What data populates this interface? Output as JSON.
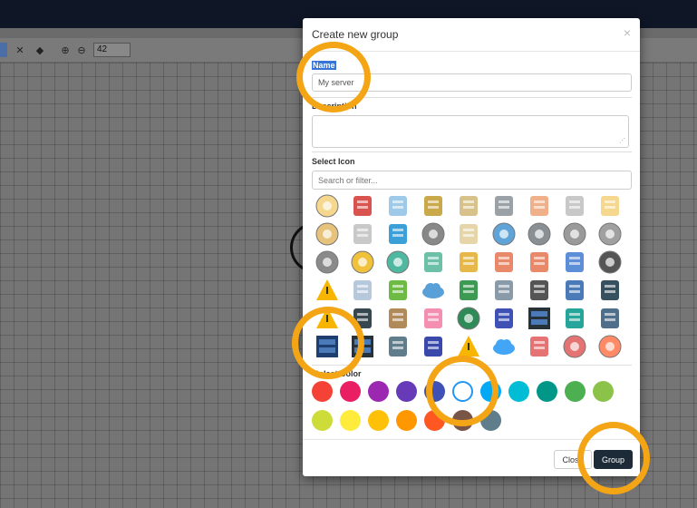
{
  "toolbar": {
    "zoom_value": "42"
  },
  "dialog": {
    "title": "Create new group",
    "close_glyph": "×",
    "name_label": "Name",
    "name_value": "My server",
    "description_label": "Description",
    "description_value": "",
    "select_icon_label": "Select Icon",
    "search_placeholder": "Search or filter...",
    "select_color_label": "Select Color",
    "close_button": "Close",
    "group_button": "Group"
  },
  "icons": [
    "keyhole-icon",
    "hacker-icon",
    "monitor-icon",
    "network-hub-icon",
    "database-icon",
    "server-tower-icon",
    "firewall-wall-icon",
    "server-icon",
    "search-shield-icon",
    "lock-icon",
    "usb-stick-icon",
    "network-graph-icon",
    "dashed-circle-icon",
    "document-key-icon",
    "compass-icon",
    "gears-icon",
    "disc-icon",
    "cd-icon",
    "gear-pair-icon",
    "keyhole-circle-icon",
    "user-circle-icon",
    "user-badge-icon",
    "satellite-dish-icon",
    "firewall-window-icon",
    "firewall-window-2-icon",
    "globe-window-icon",
    "dotted-circle-icon",
    "radiation-icon",
    "office-building-icon",
    "bus-icon",
    "cloud-icon",
    "calculator-icon",
    "photocopier-icon",
    "power-tower-icon",
    "house-network-icon",
    "laptop-icon",
    "lightning-icon",
    "smartphone-icon",
    "money-bag-icon",
    "piggy-bank-icon",
    "spiral-icon",
    "safe-icon",
    "rack-server-icon",
    "shield-check-icon",
    "robot-arm-icon",
    "server-rack-icon",
    "server-rack-2-icon",
    "delivery-truck-icon",
    "usb-drive-icon",
    "warning-icon",
    "cloud-network-icon",
    "user-box-icon",
    "play-circle-icon",
    "settings-cog-icon"
  ],
  "colors": [
    "#f44336",
    "#e91e63",
    "#9c27b0",
    "#673ab7",
    "#3f51b5",
    "#2196f3",
    "#03a9f4",
    "#00bcd4",
    "#009688",
    "#4caf50",
    "#8bc34a",
    "#cddc39",
    "#ffeb3b",
    "#ffc107",
    "#ff9800",
    "#ff5722",
    "#795548",
    "#607d8b"
  ],
  "selected_color": "#2196f3",
  "highlight_color": "#f3a515"
}
